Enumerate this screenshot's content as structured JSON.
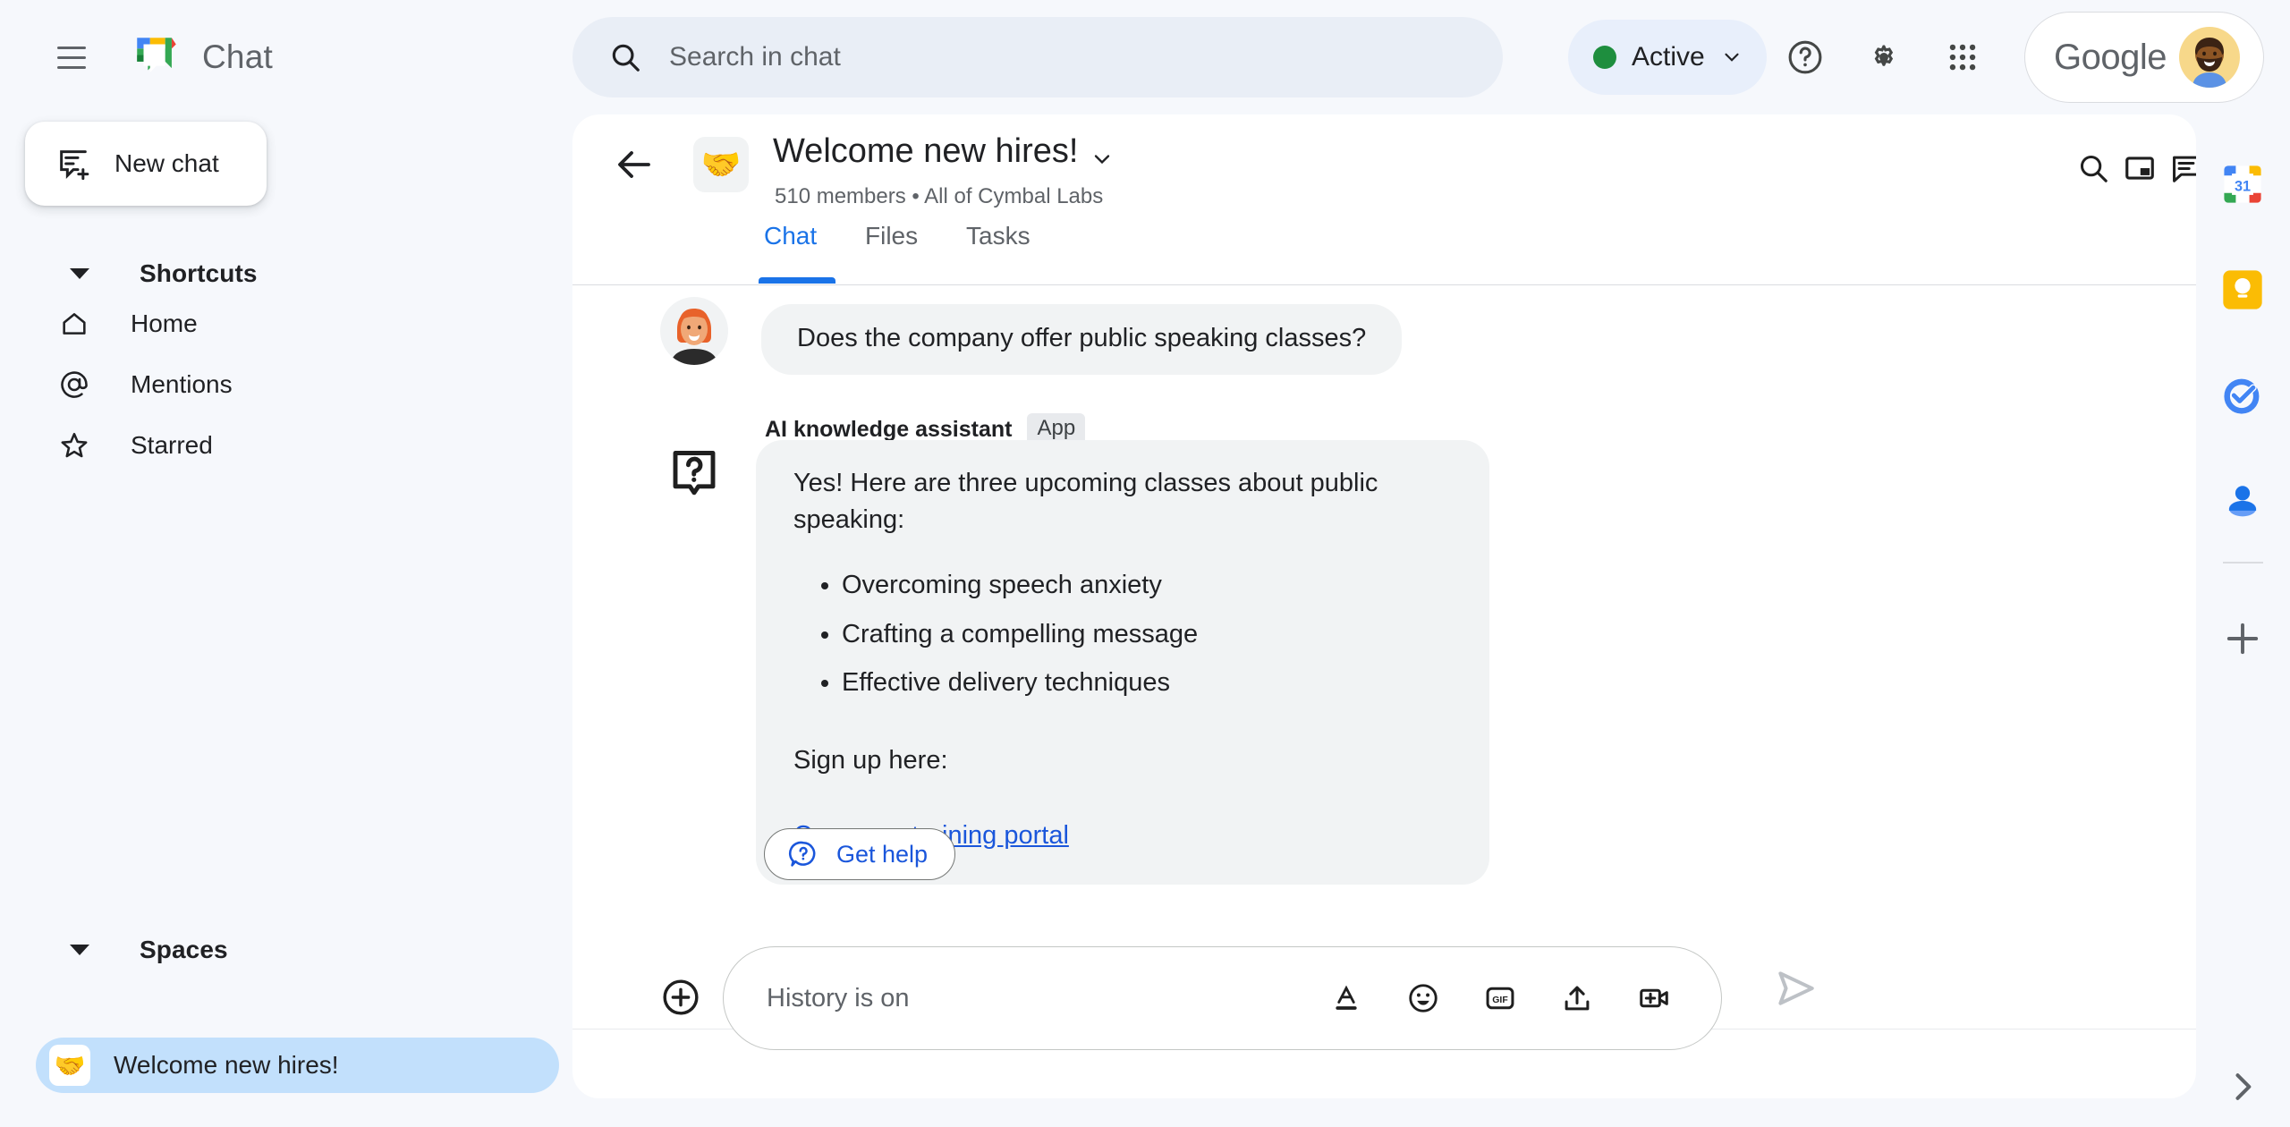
{
  "app": {
    "name": "Chat",
    "logo_icon": "google-chat-logo"
  },
  "topbar": {
    "menu_icon": "hamburger-menu-icon",
    "search": {
      "icon": "search-icon",
      "placeholder": "Search in chat",
      "value": ""
    },
    "status": {
      "label": "Active",
      "dot_color": "#1e8e3e",
      "chevron_icon": "chevron-down-icon"
    },
    "help_icon": "help-circle-icon",
    "settings_icon": "gear-icon",
    "apps_icon": "apps-grid-icon",
    "account": {
      "brand_text": "Google",
      "avatar_icon": "user-avatar"
    }
  },
  "sidebar": {
    "new_chat": {
      "label": "New chat",
      "icon": "new-chat-icon"
    },
    "shortcuts": {
      "title": "Shortcuts",
      "caret_icon": "caret-down-icon",
      "items": [
        {
          "label": "Home",
          "icon": "home-icon"
        },
        {
          "label": "Mentions",
          "icon": "at-mention-icon"
        },
        {
          "label": "Starred",
          "icon": "star-icon"
        }
      ]
    },
    "spaces": {
      "title": "Spaces",
      "caret_icon": "caret-down-icon",
      "items": [
        {
          "label": "Welcome new hires!",
          "emoji": "🤝",
          "selected": true
        }
      ]
    }
  },
  "room": {
    "back_icon": "back-arrow-icon",
    "emoji": "🤝",
    "title": "Welcome new hires!",
    "title_chevron_icon": "chevron-down-icon",
    "subtitle": "510 members  •  All of Cymbal Labs",
    "actions": [
      {
        "icon": "search-icon",
        "name": "search-in-space-button"
      },
      {
        "icon": "open-in-pip-icon",
        "name": "picture-in-picture-button"
      },
      {
        "icon": "conversation-list-icon",
        "name": "conversations-button"
      }
    ],
    "tabs": [
      {
        "label": "Chat",
        "active": true
      },
      {
        "label": "Files",
        "active": false
      },
      {
        "label": "Tasks",
        "active": false
      }
    ]
  },
  "messages": [
    {
      "type": "user",
      "avatar_icon": "woman-avatar",
      "text": "Does the company offer public speaking classes?"
    },
    {
      "type": "app",
      "sender": "AI knowledge assistant",
      "badge": "App",
      "avatar_icon": "question-bubble-icon",
      "intro": "Yes! Here are three upcoming classes about public speaking:",
      "bullets": [
        "Overcoming speech anxiety",
        "Crafting a compelling message",
        "Effective delivery techniques"
      ],
      "signup_text": "Sign up here:",
      "link_text": "Company training portal"
    }
  ],
  "get_help_button": {
    "label": "Get help",
    "icon": "help-bubble-icon"
  },
  "composer": {
    "add_icon": "plus-circle-icon",
    "placeholder": "History is on",
    "value": "",
    "tools": [
      {
        "icon": "format-text-icon",
        "name": "format-button"
      },
      {
        "icon": "emoji-icon",
        "name": "emoji-button"
      },
      {
        "icon": "gif-icon",
        "name": "gif-button",
        "label": "GIF"
      },
      {
        "icon": "upload-icon",
        "name": "upload-file-button"
      },
      {
        "icon": "add-video-icon",
        "name": "add-meeting-button"
      }
    ],
    "send_icon": "send-icon"
  },
  "right_rail": {
    "items": [
      {
        "icon": "google-calendar-icon",
        "name": "calendar"
      },
      {
        "icon": "google-keep-icon",
        "name": "keep"
      },
      {
        "icon": "google-tasks-icon",
        "name": "tasks"
      },
      {
        "icon": "google-contacts-icon",
        "name": "contacts"
      }
    ],
    "add_icon": "plus-icon",
    "expand_icon": "chevron-right-icon"
  },
  "colors": {
    "accent_blue": "#1a73e8",
    "link_blue": "#1a56db",
    "surface": "#ffffff",
    "background": "#f6f8fc",
    "bubble": "#f1f3f4",
    "selected_space": "#c2e0fc"
  }
}
